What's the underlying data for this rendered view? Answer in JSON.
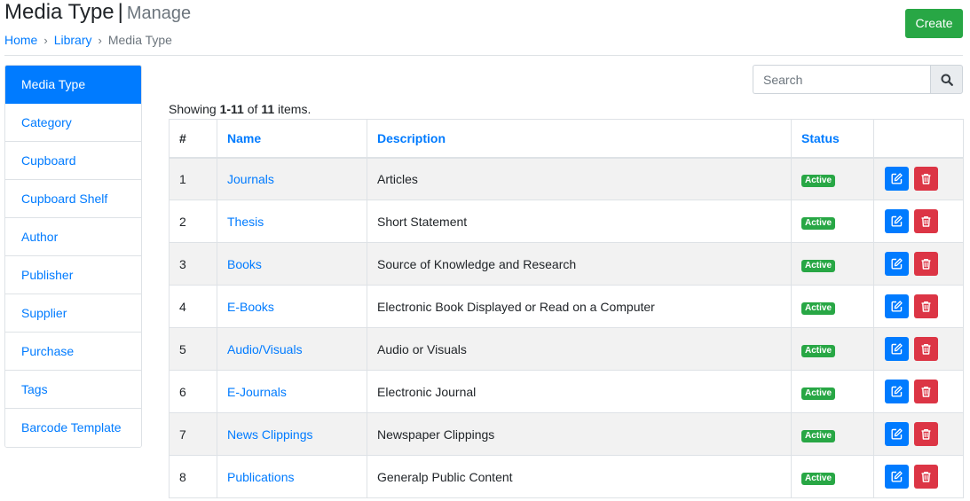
{
  "header": {
    "title": "Media Type",
    "separator": "|",
    "subtitle": "Manage",
    "create_label": "Create"
  },
  "breadcrumb": {
    "items": [
      "Home",
      "Library",
      "Media Type"
    ],
    "separator": "›"
  },
  "sidebar": {
    "items": [
      {
        "label": "Media Type",
        "active": true
      },
      {
        "label": "Category"
      },
      {
        "label": "Cupboard"
      },
      {
        "label": "Cupboard Shelf"
      },
      {
        "label": "Author"
      },
      {
        "label": "Publisher"
      },
      {
        "label": "Supplier"
      },
      {
        "label": "Purchase"
      },
      {
        "label": "Tags"
      },
      {
        "label": "Barcode Template"
      }
    ]
  },
  "search": {
    "placeholder": "Search",
    "value": ""
  },
  "summary": {
    "prefix": "Showing ",
    "range": "1-11",
    "of": " of ",
    "total": "11",
    "suffix": " items."
  },
  "table": {
    "columns": [
      "#",
      "Name",
      "Description",
      "Status"
    ],
    "rows": [
      {
        "num": "1",
        "name": "Journals",
        "description": "Articles",
        "status": "Active"
      },
      {
        "num": "2",
        "name": "Thesis",
        "description": "Short Statement",
        "status": "Active"
      },
      {
        "num": "3",
        "name": "Books",
        "description": "Source of Knowledge and Research",
        "status": "Active"
      },
      {
        "num": "4",
        "name": "E-Books",
        "description": "Electronic Book Displayed or Read on a Computer",
        "status": "Active"
      },
      {
        "num": "5",
        "name": "Audio/Visuals",
        "description": "Audio or Visuals",
        "status": "Active"
      },
      {
        "num": "6",
        "name": "E-Journals",
        "description": "Electronic Journal",
        "status": "Active"
      },
      {
        "num": "7",
        "name": "News Clippings",
        "description": "Newspaper Clippings",
        "status": "Active"
      },
      {
        "num": "8",
        "name": "Publications",
        "description": "Generalp Public Content",
        "status": "Active"
      }
    ]
  },
  "icons": {
    "search": "search-icon",
    "edit": "edit-icon",
    "delete": "trash-icon"
  },
  "colors": {
    "primary": "#007bff",
    "success": "#28a745",
    "danger": "#dc3545",
    "muted": "#6c757d"
  }
}
